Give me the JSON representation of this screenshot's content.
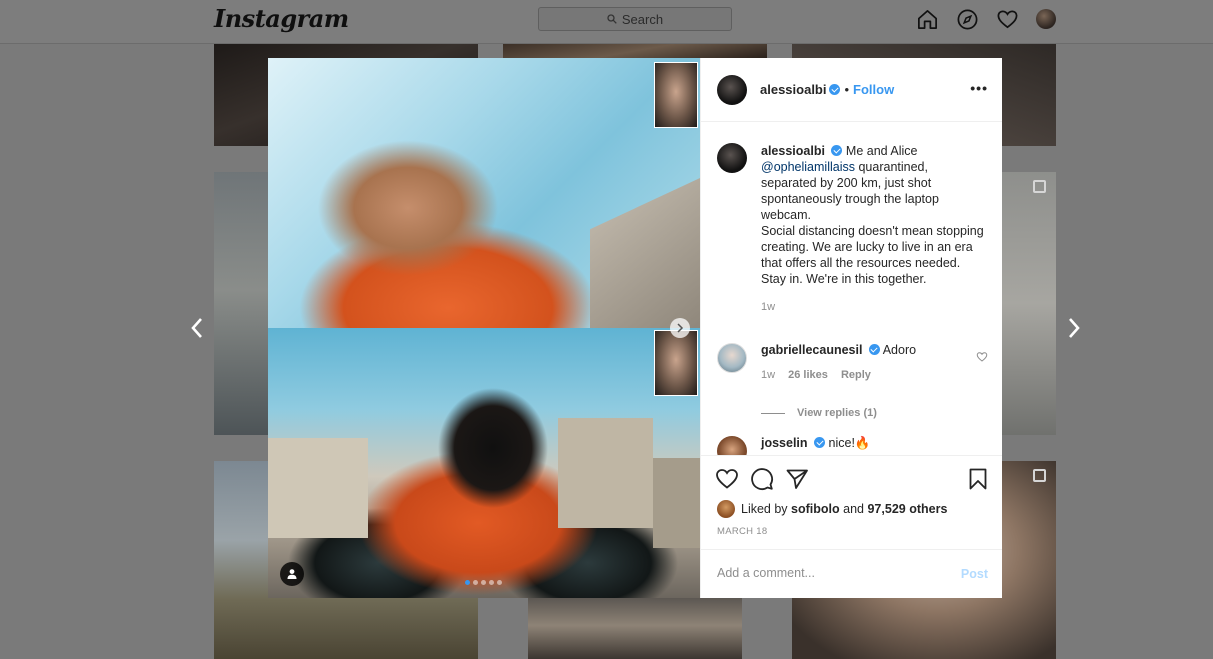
{
  "nav": {
    "logo": "Instagram",
    "search_placeholder": "Search",
    "icons": [
      "home-icon",
      "explore-compass-icon",
      "activity-heart-icon",
      "profile-avatar"
    ]
  },
  "post": {
    "author": "alessioalbi",
    "verified": true,
    "follow_label": "Follow",
    "more_label": "•••",
    "bullet": "•",
    "caption": {
      "author": "alessioalbi",
      "lines": [
        "Me and Alice",
        "@opheliamillaiss",
        "quarantined, separated by 200 km, just shot spontaneously trough the laptop webcam.",
        "Social distancing doesn't mean stopping creating. We are lucky to live in an era that offers all the resources needed.",
        "Stay in. We're in this together."
      ],
      "time": "1w"
    },
    "comments": [
      {
        "author": "gabriellecaunesil",
        "verified": true,
        "text": "Adoro",
        "time": "1w",
        "likes": "26 likes",
        "reply_label": "Reply",
        "view_replies": "View replies (1)"
      },
      {
        "author": "josselin",
        "verified": true,
        "text": "nice!🔥"
      }
    ],
    "liked_by": {
      "prefix": "Liked by",
      "user": "sofibolo",
      "and": "and",
      "others": "97,529 others"
    },
    "date": "MARCH 18",
    "comment_placeholder": "Add a comment...",
    "post_label": "Post",
    "carousel": {
      "count": 5,
      "active": 1
    },
    "colors": {
      "accent": "#3897f0",
      "post_disabled": "#b3dbff",
      "muted": "#8e8e8e"
    }
  }
}
